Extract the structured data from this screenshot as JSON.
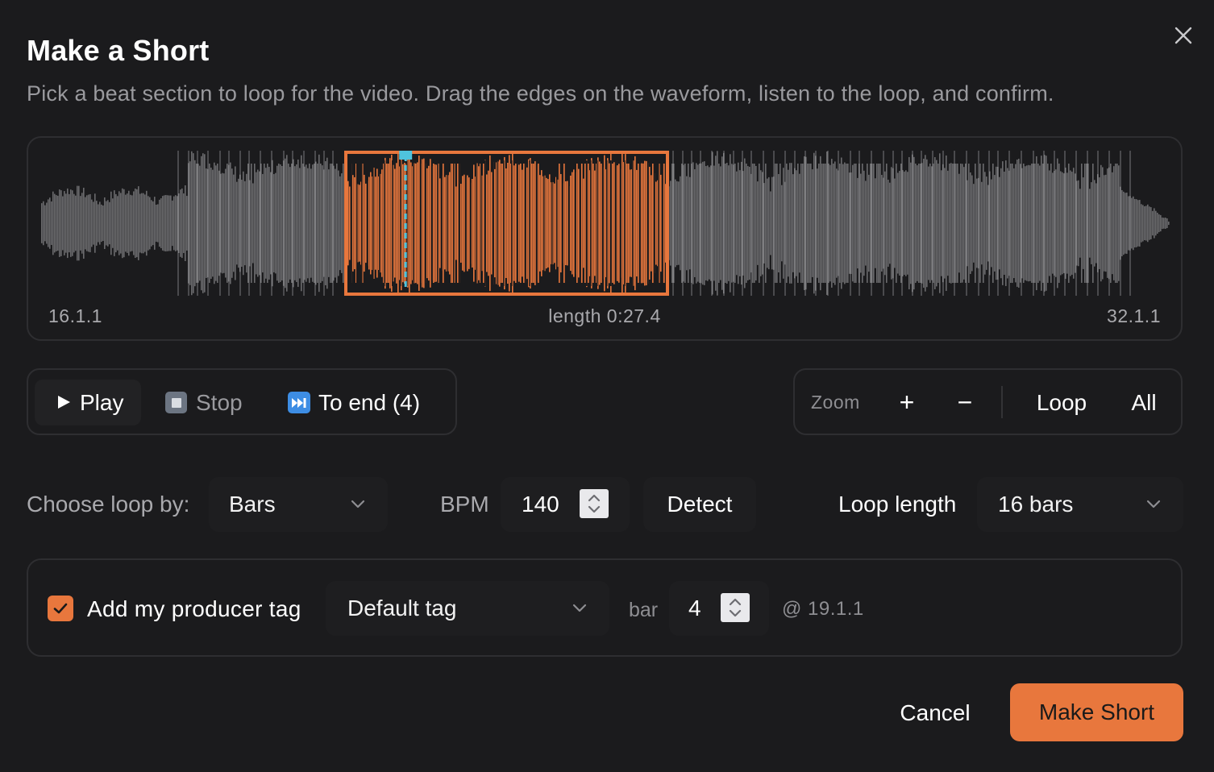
{
  "dialog": {
    "title": "Make a Short",
    "subtitle": "Pick a beat section to loop for the video. Drag the edges on the waveform, listen to the loop, and confirm."
  },
  "waveform": {
    "start_label": "16.1.1",
    "length_label": "length 0:27.4",
    "end_label": "32.1.1",
    "selection_start_fraction": 0.27,
    "selection_end_fraction": 0.555,
    "playhead_fraction": 0.323,
    "colors": {
      "wave": "#6b6b6d",
      "selection": "#e8773d",
      "playhead": "#4fc3dd",
      "bar_line": "#c8c8cc"
    }
  },
  "transport": {
    "play_label": "Play",
    "stop_label": "Stop",
    "to_end_label": "To end (4)"
  },
  "zoom": {
    "label": "Zoom",
    "plus": "+",
    "minus": "−",
    "loop": "Loop",
    "all": "All"
  },
  "loop_settings": {
    "choose_label": "Choose loop by:",
    "choose_value": "Bars",
    "bpm_label": "BPM",
    "bpm_value": "140",
    "detect_label": "Detect",
    "length_label": "Loop length",
    "length_value": "16 bars"
  },
  "producer_tag": {
    "checked": true,
    "label": "Add my producer tag",
    "tag_value": "Default tag",
    "bar_label": "bar",
    "bar_value": "4",
    "position_text": "@ 19.1.1"
  },
  "footer": {
    "cancel_label": "Cancel",
    "make_label": "Make Short"
  },
  "accent_color": "#e8773d"
}
